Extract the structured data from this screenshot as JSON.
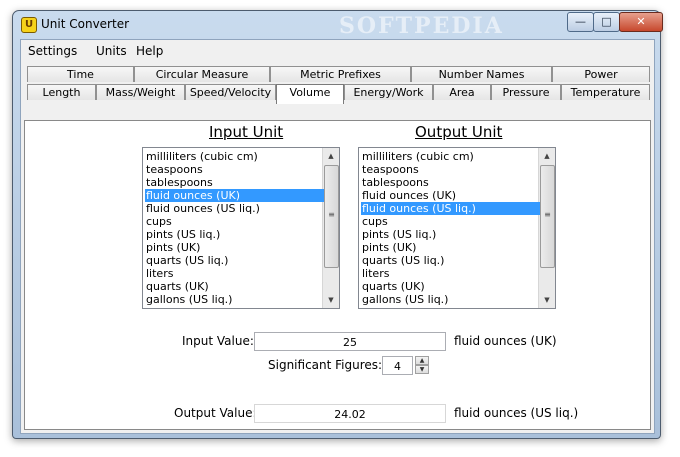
{
  "window": {
    "title": "Unit Converter",
    "watermark": "SOFTPEDIA"
  },
  "window_buttons": {
    "minimize": "—",
    "maximize": "□",
    "close": "✕"
  },
  "menu": [
    "Settings",
    "Units",
    "Help"
  ],
  "tabs_row1": [
    "Time",
    "Circular Measure",
    "Metric Prefixes",
    "Number Names",
    "Power"
  ],
  "tabs_row2": [
    "Length",
    "Mass/Weight",
    "Speed/Velocity",
    "Volume",
    "Energy/Work",
    "Area",
    "Pressure",
    "Temperature"
  ],
  "active_tab": "Volume",
  "input": {
    "header": "Input Unit",
    "items": [
      "milliliters (cubic cm)",
      "teaspoons",
      "tablespoons",
      "fluid ounces (UK)",
      "fluid ounces (US liq.)",
      "cups",
      "pints (US liq.)",
      "pints (UK)",
      "quarts (US liq.)",
      "liters",
      "quarts (UK)",
      "gallons (US liq.)"
    ],
    "selected": "fluid ounces (UK)"
  },
  "output": {
    "header": "Output Unit",
    "items": [
      "milliliters (cubic cm)",
      "teaspoons",
      "tablespoons",
      "fluid ounces (UK)",
      "fluid ounces (US liq.)",
      "cups",
      "pints (US liq.)",
      "pints (UK)",
      "quarts (US liq.)",
      "liters",
      "quarts (UK)",
      "gallons (US liq.)"
    ],
    "selected": "fluid ounces (US liq.)"
  },
  "form": {
    "input_value_label": "Input Value:",
    "input_value": "25",
    "input_unit_label": "fluid ounces (UK)",
    "sig_fig_label": "Significant Figures:",
    "sig_fig_value": "4",
    "output_value_label": "Output Value:",
    "output_value": "24.02",
    "output_unit_label": "fluid ounces (US liq.)"
  },
  "icons": {
    "app": "unit-converter-app-icon",
    "scroll_up": "scroll-up-arrow",
    "scroll_down": "scroll-down-arrow"
  }
}
